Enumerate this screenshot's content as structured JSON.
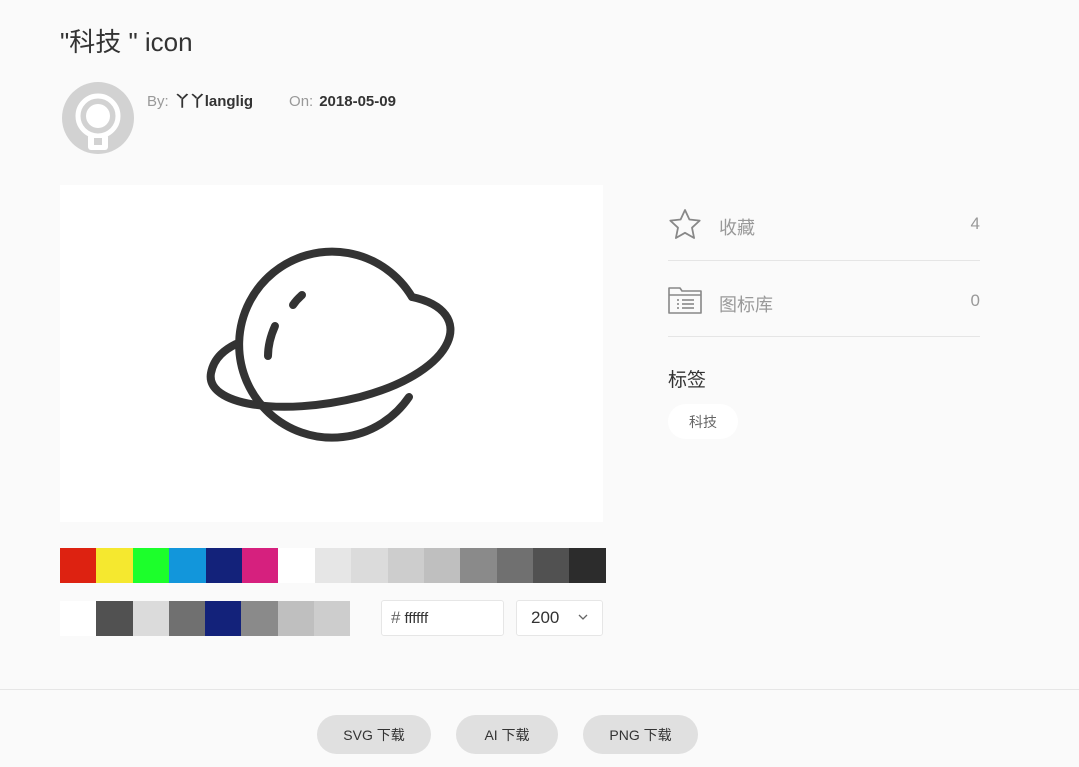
{
  "title": "\"科技 \" icon",
  "author": {
    "by_label": "By:",
    "name": "丫丫langlig",
    "on_label": "On:",
    "date": "2018-05-09"
  },
  "icon": {
    "name": "planet-icon",
    "stroke_color": "#333333"
  },
  "palette_row1": [
    "#dd2211",
    "#f5e82f",
    "#1cff2b",
    "#1296db",
    "#13227a",
    "#d6207e",
    "#ffffff",
    "#e6e6e6",
    "#dbdbdb",
    "#cdcdcd",
    "#bfbfbf",
    "#8a8a8a",
    "#707070",
    "#515151",
    "#2c2c2c"
  ],
  "palette_row2": [
    "#ffffff",
    "#515151",
    "#dbdbdb",
    "#707070",
    "#13227a",
    "#8a8a8a",
    "#bfbfbf",
    "#cdcdcd"
  ],
  "color_input": {
    "hash": "#",
    "value": "ffffff"
  },
  "size_select": {
    "value": "200"
  },
  "stats": {
    "favorites": {
      "label": "收藏",
      "count": "4",
      "icon": "star-icon"
    },
    "library": {
      "label": "图标库",
      "count": "0",
      "icon": "folder-list-icon"
    }
  },
  "tags": {
    "heading": "标签",
    "items": [
      "科技"
    ]
  },
  "downloads": {
    "svg": "SVG 下载",
    "ai": "AI 下载",
    "png": "PNG 下载"
  }
}
